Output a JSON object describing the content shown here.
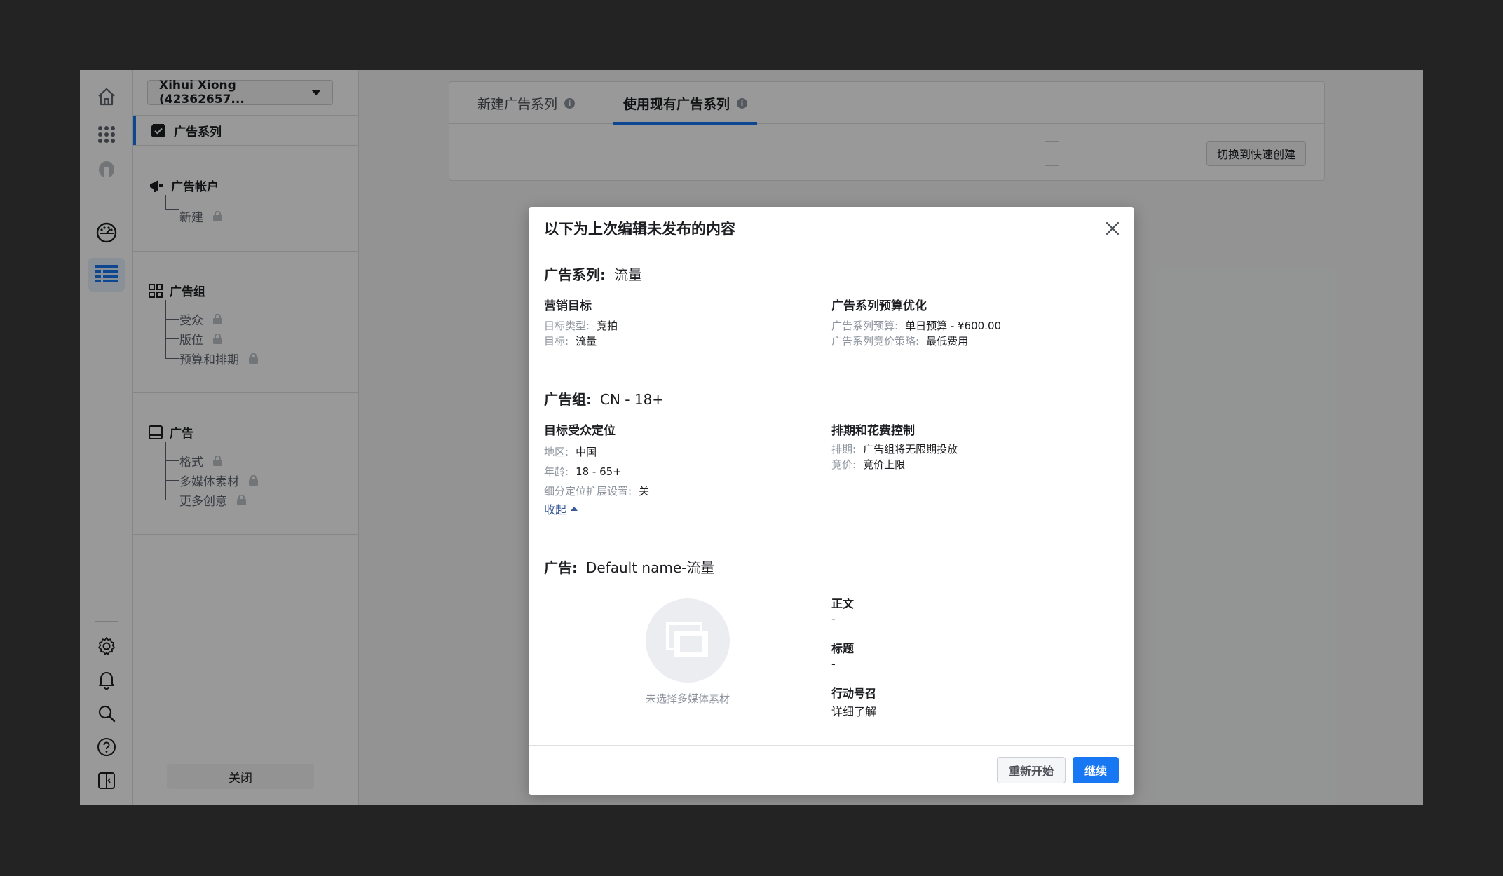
{
  "nav": {
    "account_name": "Xihui Xiong (42362657...",
    "selected_item": "广告系列",
    "sections": [
      {
        "title": "广告帐户",
        "items": [
          "新建"
        ]
      },
      {
        "title": "广告组",
        "items": [
          "受众",
          "版位",
          "预算和排期"
        ]
      },
      {
        "title": "广告",
        "items": [
          "格式",
          "多媒体素材",
          "更多创意"
        ]
      }
    ],
    "close_label": "关闭"
  },
  "main": {
    "tabs": [
      "新建广告系列",
      "使用现有广告系列"
    ],
    "active_tab_index": 1,
    "quick_create_label": "切换到快速创建"
  },
  "modal": {
    "title": "以下为上次编辑未发布的内容",
    "campaign": {
      "label": "广告系列:",
      "name": "流量",
      "left_heading": "营销目标",
      "left_rows": [
        {
          "k": "目标类型:",
          "v": "竞拍"
        },
        {
          "k": "目标:",
          "v": "流量"
        }
      ],
      "right_heading": "广告系列预算优化",
      "right_rows": [
        {
          "k": "广告系列预算:",
          "v": "单日预算 - ¥600.00"
        },
        {
          "k": "广告系列竞价策略:",
          "v": "最低费用"
        }
      ]
    },
    "adset": {
      "label": "广告组:",
      "name": "CN - 18+",
      "left_heading": "目标受众定位",
      "left_rows": [
        {
          "k": "地区:",
          "v": "中国"
        },
        {
          "k": "年龄:",
          "v": "18 - 65+"
        },
        {
          "k": "细分定位扩展设置:",
          "v": "关"
        }
      ],
      "collapse_label": "收起",
      "right_heading": "排期和花费控制",
      "right_rows": [
        {
          "k": "排期:",
          "v": "广告组将无限期投放"
        },
        {
          "k": "竞价:",
          "v": "竞价上限"
        }
      ]
    },
    "ad": {
      "label": "广告:",
      "name": "Default name-流量",
      "media_caption": "未选择多媒体素材",
      "fields": [
        {
          "label": "正文",
          "value": "-"
        },
        {
          "label": "标题",
          "value": "-"
        },
        {
          "label": "行动号召",
          "value": "详细了解"
        }
      ]
    },
    "restart_label": "重新开始",
    "continue_label": "继续"
  },
  "colors": {
    "accent": "#1877f2",
    "link": "#385898",
    "overlay": "rgba(0,0,0,0.40)",
    "outer_background": "#232323"
  },
  "icons": [
    "home-icon",
    "apps-grid-icon",
    "avatar-icon",
    "dashboard-icon",
    "table-icon",
    "gear-icon",
    "bell-icon",
    "search-icon",
    "help-icon",
    "panel-toggle-icon",
    "campaign-check-icon",
    "megaphone-icon",
    "adset-grid-icon",
    "ad-icon",
    "lock-icon",
    "info-icon",
    "close-icon",
    "media-placeholder-icon"
  ]
}
